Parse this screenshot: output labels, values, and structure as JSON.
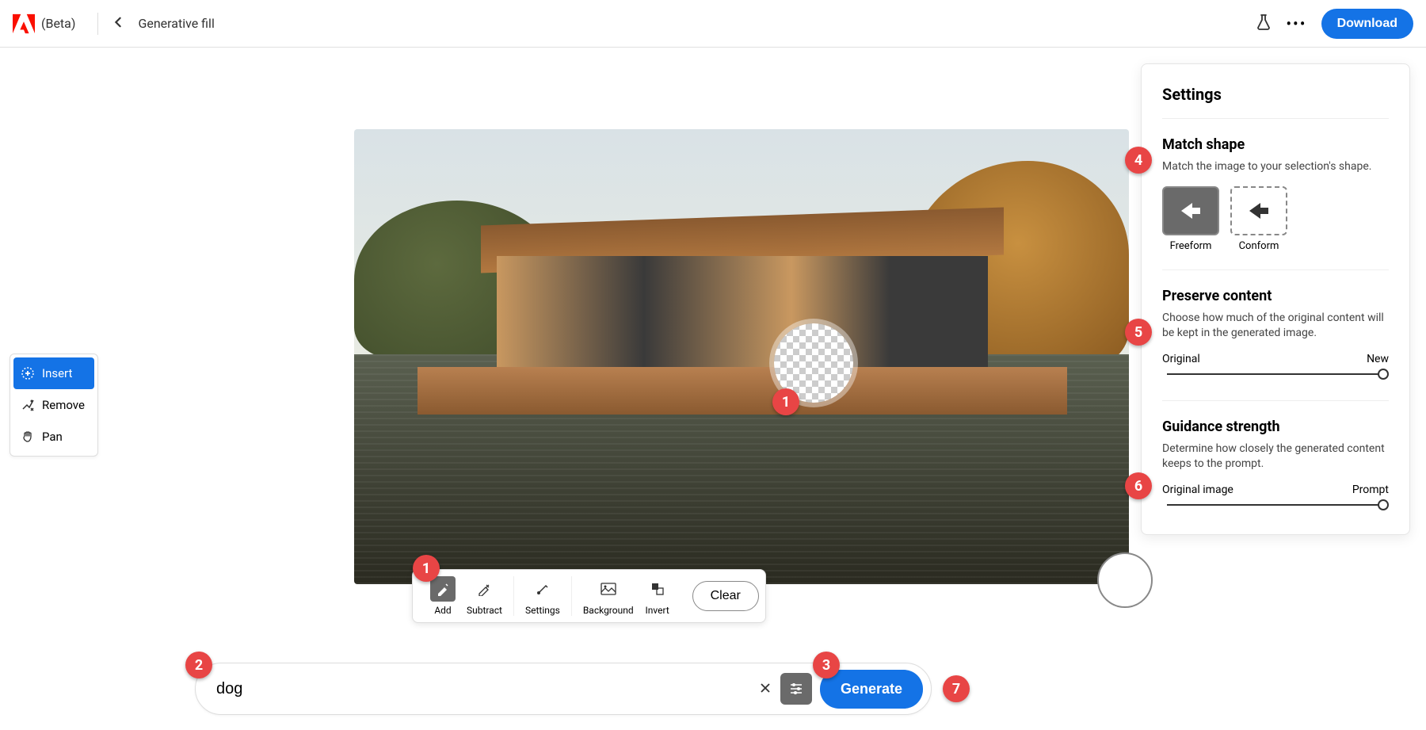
{
  "header": {
    "beta_label": "(Beta)",
    "page_title": "Generative fill",
    "download_label": "Download"
  },
  "tool_panel": {
    "items": [
      {
        "label": "Insert",
        "icon": "insert-icon",
        "active": true
      },
      {
        "label": "Remove",
        "icon": "remove-icon",
        "active": false
      },
      {
        "label": "Pan",
        "icon": "pan-icon",
        "active": false
      }
    ]
  },
  "brush_bar": {
    "items": [
      {
        "label": "Add",
        "active": true
      },
      {
        "label": "Subtract",
        "active": false
      },
      {
        "label": "Settings",
        "active": false
      },
      {
        "label": "Background",
        "active": false
      },
      {
        "label": "Invert",
        "active": false
      }
    ],
    "clear_label": "Clear"
  },
  "prompt": {
    "value": "dog",
    "generate_label": "Generate"
  },
  "settings": {
    "title": "Settings",
    "match_shape": {
      "heading": "Match shape",
      "description": "Match the image to your selection's shape.",
      "options": [
        {
          "label": "Freeform",
          "active": true
        },
        {
          "label": "Conform",
          "active": false
        }
      ]
    },
    "preserve": {
      "heading": "Preserve content",
      "description": "Choose how much of the original content will be kept in the generated image.",
      "left_label": "Original",
      "right_label": "New"
    },
    "guidance": {
      "heading": "Guidance strength",
      "description": "Determine how closely the generated content keeps to the prompt.",
      "left_label": "Original image",
      "right_label": "Prompt"
    }
  },
  "annotations": {
    "b1a": "1",
    "b1b": "1",
    "b2": "2",
    "b3": "3",
    "b4": "4",
    "b5": "5",
    "b6": "6",
    "b7": "7"
  }
}
